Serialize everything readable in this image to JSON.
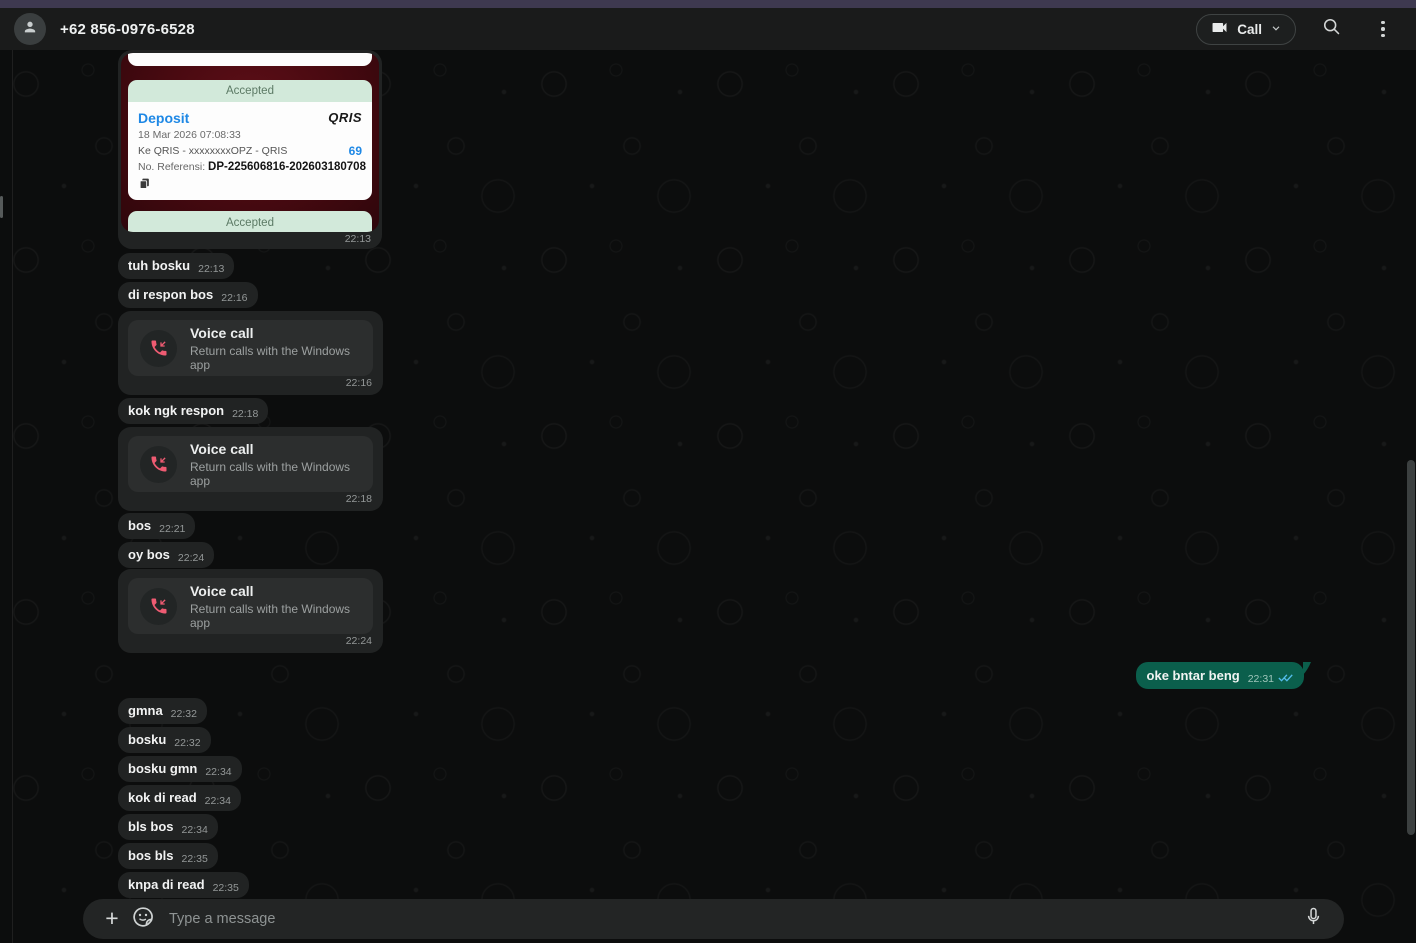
{
  "header": {
    "title": "+62 856-0976-6528",
    "call_button": {
      "label": "Call"
    }
  },
  "receipt": {
    "status_top": "Accepted",
    "status_bottom": "Accepted",
    "title": "Deposit",
    "datetime": "18 Mar 2026 07:08:33",
    "recipient": "Ke QRIS - xxxxxxxxOPZ - QRIS",
    "amount": "69",
    "ref_label": "No. Referensi: ",
    "ref_value": "DP-225606816-202603180708",
    "brand": "QRIS"
  },
  "messages": [
    {
      "kind": "image",
      "time": "22:13"
    },
    {
      "kind": "text",
      "text": "tuh bosku",
      "time": "22:13"
    },
    {
      "kind": "text",
      "text": "di respon bos",
      "time": "22:16"
    },
    {
      "kind": "voice-call",
      "title": "Voice call",
      "subtitle": "Return calls with the Windows app",
      "time": "22:16"
    },
    {
      "kind": "text",
      "text": "kok ngk respon",
      "time": "22:18"
    },
    {
      "kind": "voice-call",
      "title": "Voice call",
      "subtitle": "Return calls with the Windows app",
      "time": "22:18"
    },
    {
      "kind": "text",
      "text": "bos",
      "time": "22:21"
    },
    {
      "kind": "text",
      "text": "oy bos",
      "time": "22:24"
    },
    {
      "kind": "voice-call",
      "title": "Voice call",
      "subtitle": "Return calls with the Windows app",
      "time": "22:24"
    },
    {
      "kind": "text",
      "direction": "out",
      "text": "oke bntar beng",
      "time": "22:31",
      "status": "read"
    },
    {
      "kind": "text",
      "text": "gmna",
      "time": "22:32"
    },
    {
      "kind": "text",
      "text": "bosku",
      "time": "22:32"
    },
    {
      "kind": "text",
      "text": "bosku gmn",
      "time": "22:34"
    },
    {
      "kind": "text",
      "text": "kok di read",
      "time": "22:34"
    },
    {
      "kind": "text",
      "text": "bls bos",
      "time": "22:34"
    },
    {
      "kind": "text",
      "text": "bos bls",
      "time": "22:35"
    },
    {
      "kind": "text",
      "text": "knpa di read",
      "time": "22:35"
    }
  ],
  "composer": {
    "placeholder": "Type a message"
  },
  "colors": {
    "outgoing_bubble": "#0b5f4c",
    "incoming_bubble": "#212323",
    "read_tick_blue": "#53bdeb",
    "missed_call_pink": "#ee5b72",
    "receipt_accent_blue": "#1e88e5",
    "receipt_green": "#d2e9da",
    "receipt_red": "#4a0a11",
    "top_strip": "#3e3950"
  }
}
